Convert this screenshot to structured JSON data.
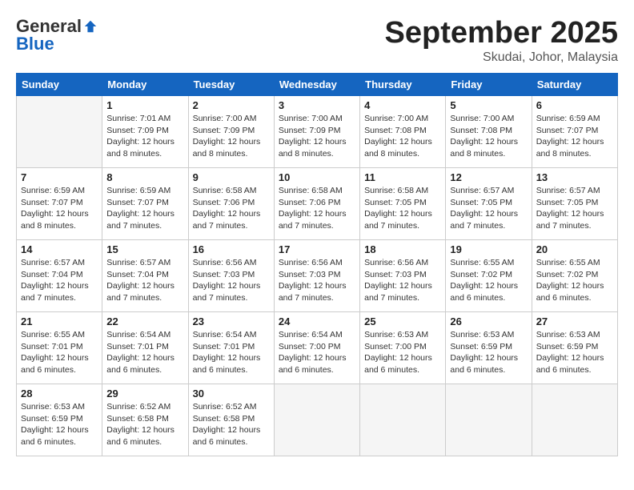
{
  "header": {
    "logo_general": "General",
    "logo_blue": "Blue",
    "month": "September 2025",
    "location": "Skudai, Johor, Malaysia"
  },
  "days_of_week": [
    "Sunday",
    "Monday",
    "Tuesday",
    "Wednesday",
    "Thursday",
    "Friday",
    "Saturday"
  ],
  "weeks": [
    [
      {
        "day": "",
        "info": ""
      },
      {
        "day": "1",
        "info": "Sunrise: 7:01 AM\nSunset: 7:09 PM\nDaylight: 12 hours\nand 8 minutes."
      },
      {
        "day": "2",
        "info": "Sunrise: 7:00 AM\nSunset: 7:09 PM\nDaylight: 12 hours\nand 8 minutes."
      },
      {
        "day": "3",
        "info": "Sunrise: 7:00 AM\nSunset: 7:09 PM\nDaylight: 12 hours\nand 8 minutes."
      },
      {
        "day": "4",
        "info": "Sunrise: 7:00 AM\nSunset: 7:08 PM\nDaylight: 12 hours\nand 8 minutes."
      },
      {
        "day": "5",
        "info": "Sunrise: 7:00 AM\nSunset: 7:08 PM\nDaylight: 12 hours\nand 8 minutes."
      },
      {
        "day": "6",
        "info": "Sunrise: 6:59 AM\nSunset: 7:07 PM\nDaylight: 12 hours\nand 8 minutes."
      }
    ],
    [
      {
        "day": "7",
        "info": "Sunrise: 6:59 AM\nSunset: 7:07 PM\nDaylight: 12 hours\nand 8 minutes."
      },
      {
        "day": "8",
        "info": "Sunrise: 6:59 AM\nSunset: 7:07 PM\nDaylight: 12 hours\nand 7 minutes."
      },
      {
        "day": "9",
        "info": "Sunrise: 6:58 AM\nSunset: 7:06 PM\nDaylight: 12 hours\nand 7 minutes."
      },
      {
        "day": "10",
        "info": "Sunrise: 6:58 AM\nSunset: 7:06 PM\nDaylight: 12 hours\nand 7 minutes."
      },
      {
        "day": "11",
        "info": "Sunrise: 6:58 AM\nSunset: 7:05 PM\nDaylight: 12 hours\nand 7 minutes."
      },
      {
        "day": "12",
        "info": "Sunrise: 6:57 AM\nSunset: 7:05 PM\nDaylight: 12 hours\nand 7 minutes."
      },
      {
        "day": "13",
        "info": "Sunrise: 6:57 AM\nSunset: 7:05 PM\nDaylight: 12 hours\nand 7 minutes."
      }
    ],
    [
      {
        "day": "14",
        "info": "Sunrise: 6:57 AM\nSunset: 7:04 PM\nDaylight: 12 hours\nand 7 minutes."
      },
      {
        "day": "15",
        "info": "Sunrise: 6:57 AM\nSunset: 7:04 PM\nDaylight: 12 hours\nand 7 minutes."
      },
      {
        "day": "16",
        "info": "Sunrise: 6:56 AM\nSunset: 7:03 PM\nDaylight: 12 hours\nand 7 minutes."
      },
      {
        "day": "17",
        "info": "Sunrise: 6:56 AM\nSunset: 7:03 PM\nDaylight: 12 hours\nand 7 minutes."
      },
      {
        "day": "18",
        "info": "Sunrise: 6:56 AM\nSunset: 7:03 PM\nDaylight: 12 hours\nand 7 minutes."
      },
      {
        "day": "19",
        "info": "Sunrise: 6:55 AM\nSunset: 7:02 PM\nDaylight: 12 hours\nand 6 minutes."
      },
      {
        "day": "20",
        "info": "Sunrise: 6:55 AM\nSunset: 7:02 PM\nDaylight: 12 hours\nand 6 minutes."
      }
    ],
    [
      {
        "day": "21",
        "info": "Sunrise: 6:55 AM\nSunset: 7:01 PM\nDaylight: 12 hours\nand 6 minutes."
      },
      {
        "day": "22",
        "info": "Sunrise: 6:54 AM\nSunset: 7:01 PM\nDaylight: 12 hours\nand 6 minutes."
      },
      {
        "day": "23",
        "info": "Sunrise: 6:54 AM\nSunset: 7:01 PM\nDaylight: 12 hours\nand 6 minutes."
      },
      {
        "day": "24",
        "info": "Sunrise: 6:54 AM\nSunset: 7:00 PM\nDaylight: 12 hours\nand 6 minutes."
      },
      {
        "day": "25",
        "info": "Sunrise: 6:53 AM\nSunset: 7:00 PM\nDaylight: 12 hours\nand 6 minutes."
      },
      {
        "day": "26",
        "info": "Sunrise: 6:53 AM\nSunset: 6:59 PM\nDaylight: 12 hours\nand 6 minutes."
      },
      {
        "day": "27",
        "info": "Sunrise: 6:53 AM\nSunset: 6:59 PM\nDaylight: 12 hours\nand 6 minutes."
      }
    ],
    [
      {
        "day": "28",
        "info": "Sunrise: 6:53 AM\nSunset: 6:59 PM\nDaylight: 12 hours\nand 6 minutes."
      },
      {
        "day": "29",
        "info": "Sunrise: 6:52 AM\nSunset: 6:58 PM\nDaylight: 12 hours\nand 6 minutes."
      },
      {
        "day": "30",
        "info": "Sunrise: 6:52 AM\nSunset: 6:58 PM\nDaylight: 12 hours\nand 6 minutes."
      },
      {
        "day": "",
        "info": ""
      },
      {
        "day": "",
        "info": ""
      },
      {
        "day": "",
        "info": ""
      },
      {
        "day": "",
        "info": ""
      }
    ]
  ]
}
